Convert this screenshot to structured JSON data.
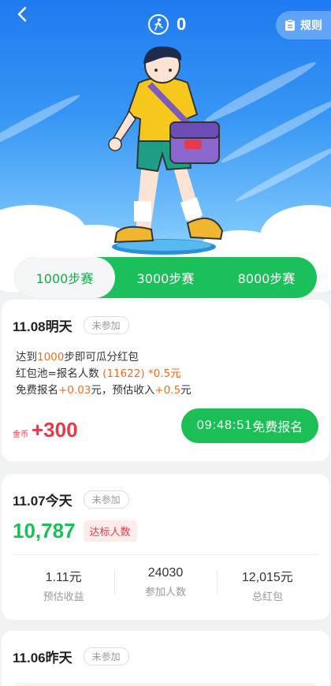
{
  "header": {
    "step_count": "0",
    "rules_label": "规则"
  },
  "tabs": [
    {
      "label": "1000步赛",
      "active": true
    },
    {
      "label": "3000步赛",
      "active": false
    },
    {
      "label": "8000步赛",
      "active": false
    }
  ],
  "upcoming": {
    "date": "11.08明天",
    "status": "未参加",
    "rule_line1_pre": "达到",
    "rule_line1_steps": "1000",
    "rule_line1_post": "步即可瓜分红包",
    "rule_line2_pre": "红包池=报名人数",
    "rule_line2_count": "(11622)",
    "rule_line2_mult": "*0.5元",
    "rule_line3_pre": "免费报名",
    "rule_line3_fee": "+0.03",
    "rule_line3_mid": "元，预估收入",
    "rule_line3_income": "+0.5",
    "rule_line3_post": "元",
    "reward_caption": "金币",
    "reward_amount": "+300",
    "countdown": "09:48:51",
    "signup_label": "免费报名"
  },
  "today": {
    "date": "11.07今天",
    "status": "未参加",
    "qualified_count": "10,787",
    "qualified_label": "达标人数",
    "stats": [
      {
        "value": "1.11元",
        "label": "预估收益"
      },
      {
        "value": "24030",
        "label": "参加人数"
      },
      {
        "value": "12,015元",
        "label": "总红包"
      }
    ]
  },
  "yesterday": {
    "date": "11.06昨天",
    "status": "未参加"
  },
  "colors": {
    "green": "#1bbf56",
    "orange": "#f56a1c",
    "red": "#e8394a",
    "hero_blue": "#1f7bf0"
  },
  "icons": [
    "back-arrow-icon",
    "walking-icon",
    "clipboard-icon"
  ]
}
